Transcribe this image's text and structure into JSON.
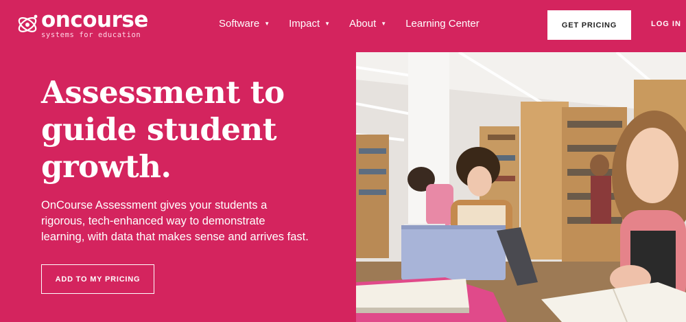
{
  "header": {
    "logo": {
      "wordmark": "oncourse",
      "tagline": "systems for education"
    },
    "nav": [
      {
        "label": "Software",
        "has_dropdown": true
      },
      {
        "label": "Impact",
        "has_dropdown": true
      },
      {
        "label": "About",
        "has_dropdown": true
      },
      {
        "label": "Learning Center",
        "has_dropdown": false
      }
    ],
    "cta_label": "GET PRICING",
    "login_label": "LOG IN"
  },
  "hero": {
    "headline_lines": [
      "Assessment to",
      "guide student",
      "growth."
    ],
    "subtext_lines": [
      "OnCourse Assessment gives your students a",
      "rigorous, tech-enhanced way to demonstrate",
      "learning, with data that makes sense and arrives fast."
    ],
    "button_label": "ADD TO MY PRICING"
  },
  "colors": {
    "brand": "#d4245e",
    "text": "#ffffff",
    "cta_bg": "#ffffff",
    "cta_text": "#222222"
  },
  "icons": {
    "logo_mark": "atom-orbit-icon",
    "dropdown": "caret-down-icon"
  }
}
